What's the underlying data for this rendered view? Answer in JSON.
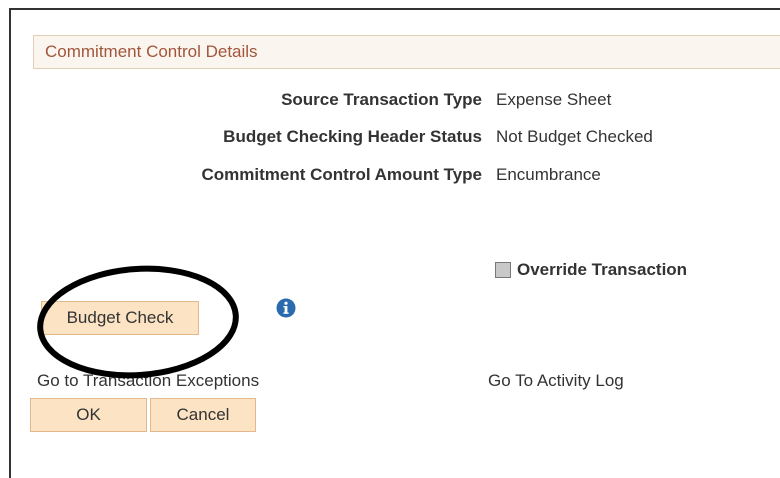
{
  "section": {
    "title": "Commitment Control Details"
  },
  "fields": [
    {
      "label": "Source Transaction Type",
      "value": "Expense Sheet"
    },
    {
      "label": "Budget Checking Header Status",
      "value": "Not Budget Checked"
    },
    {
      "label": "Commitment Control Amount Type",
      "value": "Encumbrance"
    }
  ],
  "override": {
    "label": "Override Transaction",
    "checked": false
  },
  "buttons": {
    "budget_check": "Budget Check",
    "ok": "OK",
    "cancel": "Cancel"
  },
  "links": {
    "transaction_exceptions": "Go to Transaction Exceptions",
    "activity_log": "Go To Activity Log"
  },
  "icons": {
    "info": "info-icon"
  },
  "colors": {
    "header_text": "#a2553a",
    "header_bg": "#faf6ef",
    "button_bg": "#fbe3c4",
    "info_icon": "#2a6bb0"
  }
}
